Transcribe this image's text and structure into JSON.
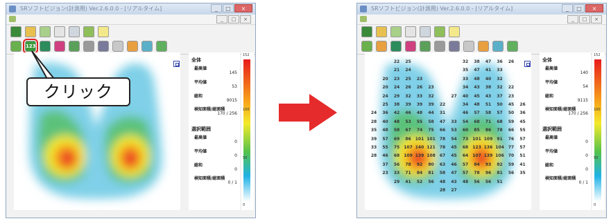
{
  "window": {
    "title": "SRソフトビジョン(計測用) Ver.2.6.0.0 - [リアルタイム]",
    "controls": [
      "_",
      "□",
      "×"
    ],
    "mdi_controls": [
      "_",
      "□",
      "×"
    ]
  },
  "callout": {
    "text": "クリック"
  },
  "left_panel": {
    "overall": {
      "heading": "全体",
      "max_label": "最高値",
      "max_value": "145",
      "avg_label": "平均値",
      "avg_value": "53",
      "sum_label": "総和",
      "sum_value": "9015",
      "area_label": "検知面積/総面積",
      "area_value": "170 / 256"
    },
    "selection": {
      "heading": "選択範囲",
      "max_label": "最高値",
      "max_value": "0",
      "avg_label": "平均値",
      "avg_value": "0",
      "sum_label": "総和",
      "sum_value": "0",
      "area_label": "検知面積/総面積",
      "area_value": "0 / 1"
    },
    "colorbar": {
      "top": "152",
      "mid1": "100",
      "mid2": "50",
      "bottom": "0"
    }
  },
  "right_panel": {
    "overall": {
      "heading": "全体",
      "max_label": "最高値",
      "max_value": "140",
      "avg_label": "平均値",
      "avg_value": "54",
      "sum_label": "総和",
      "sum_value": "9115",
      "area_label": "検知面積/総面積",
      "area_value": "170 / 256"
    },
    "selection": {
      "heading": "選択範囲",
      "max_label": "最高値",
      "max_value": "0",
      "avg_label": "平均値",
      "avg_value": "0",
      "sum_label": "総和",
      "sum_value": "0",
      "area_label": "検知面積/総面積",
      "area_value": "0 / 1"
    },
    "colorbar": {
      "top": "152",
      "mid1": "100",
      "mid2": "50",
      "bottom": "0"
    }
  },
  "grid_rows": [
    [
      "",
      "",
      "22",
      "25",
      "",
      "",
      "",
      "",
      "32",
      "38",
      "47",
      "36",
      "26",
      ""
    ],
    [
      "",
      "",
      "21",
      "24",
      "",
      "",
      "",
      "",
      "35",
      "47",
      "41",
      "33",
      "",
      ""
    ],
    [
      "",
      "20",
      "23",
      "25",
      "23",
      "",
      "",
      "",
      "33",
      "48",
      "40",
      "32",
      "",
      ""
    ],
    [
      "",
      "20",
      "24",
      "26",
      "26",
      "23",
      "",
      "",
      "34",
      "43",
      "38",
      "32",
      "22",
      ""
    ],
    [
      "",
      "24",
      "29",
      "32",
      "33",
      "32",
      "",
      "27",
      "40",
      "45",
      "43",
      "37",
      "23",
      ""
    ],
    [
      "",
      "25",
      "38",
      "39",
      "39",
      "39",
      "22",
      "",
      "34",
      "48",
      "51",
      "50",
      "45",
      "26"
    ],
    [
      "24",
      "36",
      "42",
      "46",
      "48",
      "44",
      "31",
      "",
      "46",
      "57",
      "58",
      "57",
      "50",
      "36"
    ],
    [
      "28",
      "40",
      "48",
      "53",
      "55",
      "58",
      "47",
      "33",
      "54",
      "68",
      "71",
      "68",
      "59",
      "45"
    ],
    [
      "35",
      "48",
      "58",
      "67",
      "74",
      "75",
      "66",
      "53",
      "60",
      "85",
      "86",
      "78",
      "66",
      "55"
    ],
    [
      "39",
      "57",
      "69",
      "86",
      "101",
      "101",
      "78",
      "54",
      "73",
      "101",
      "109",
      "91",
      "76",
      "57"
    ],
    [
      "33",
      "55",
      "75",
      "107",
      "140",
      "121",
      "78",
      "45",
      "68",
      "123",
      "136",
      "104",
      "77",
      "57"
    ],
    [
      "28",
      "46",
      "68",
      "109",
      "139",
      "108",
      "67",
      "45",
      "64",
      "107",
      "139",
      "106",
      "70",
      "51"
    ],
    [
      "",
      "37",
      "56",
      "78",
      "92",
      "80",
      "63",
      "46",
      "57",
      "84",
      "93",
      "82",
      "59",
      "41"
    ],
    [
      "",
      "23",
      "33",
      "71",
      "84",
      "81",
      "58",
      "47",
      "57",
      "78",
      "96",
      "81",
      "56",
      "35"
    ],
    [
      "",
      "",
      "29",
      "41",
      "52",
      "56",
      "48",
      "43",
      "48",
      "56",
      "56",
      "51",
      "",
      ""
    ],
    [
      "",
      "",
      "",
      "",
      "",
      "",
      "28",
      "27",
      "",
      "",
      "",
      "",
      "",
      ""
    ]
  ],
  "colors": {
    "highlight": "#e02020",
    "arrow": "#e52b2b"
  }
}
